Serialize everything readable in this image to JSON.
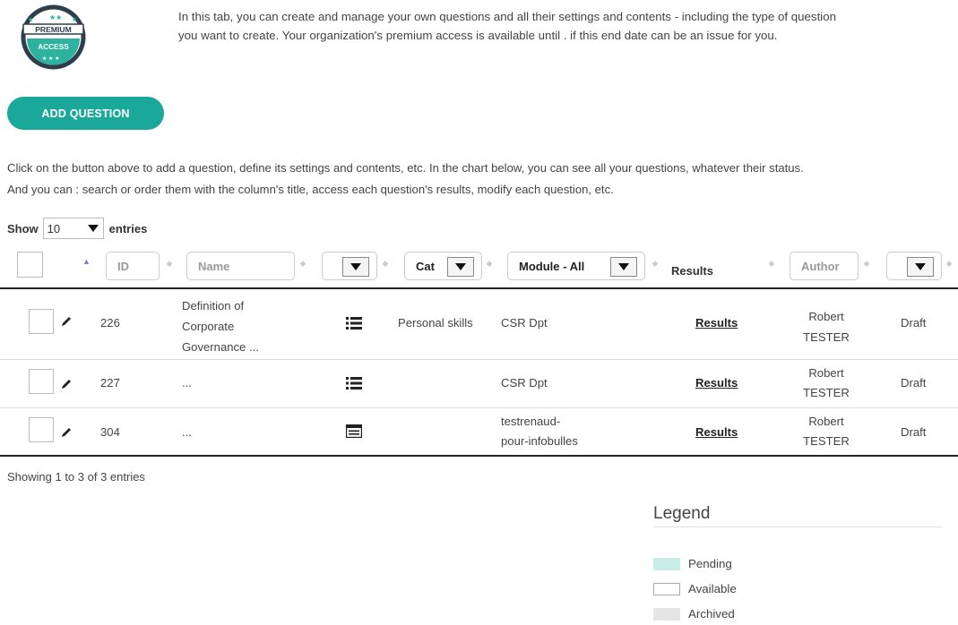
{
  "badge": {
    "top_text": "PREMIUM",
    "bottom_text": "ACCESS"
  },
  "intro": {
    "line1": "In this tab, you can create and manage your own questions and all their settings and contents - including the type of question",
    "line2": "you want to create. Your organization's premium access is available until . if this end date can be an issue for you."
  },
  "add_button": "ADD QUESTION",
  "description": {
    "line1": "Click on the button above to add a question, define its settings and contents, etc. In the chart below, you can see all your questions, whatever their status.",
    "line2": "And you can : search or order them with the column's title, access each question's results, modify each question, etc."
  },
  "show_entries": {
    "show": "Show",
    "value": "10",
    "entries": "entries"
  },
  "filters": {
    "id_placeholder": "ID",
    "name_placeholder": "Name",
    "type_value": "",
    "category_value": "Cat",
    "module_value": "Module - All",
    "results_header": "Results",
    "author_placeholder": "Author",
    "status_value": ""
  },
  "rows": [
    {
      "id": "226",
      "name_l1": "Definition of",
      "name_l2": "Corporate",
      "name_l3": "Governance ...",
      "type_icon": "list-icon",
      "category": "Personal skills",
      "module_l1": "CSR Dpt",
      "module_l2": "",
      "results": "Results",
      "author_l1": "Robert",
      "author_l2": "TESTER",
      "status": "Draft"
    },
    {
      "id": "227",
      "name_l1": "...",
      "name_l2": "",
      "name_l3": "",
      "type_icon": "list-icon",
      "category": "",
      "module_l1": "CSR Dpt",
      "module_l2": "",
      "results": "Results",
      "author_l1": "Robert",
      "author_l2": "TESTER",
      "status": "Draft"
    },
    {
      "id": "304",
      "name_l1": "...",
      "name_l2": "",
      "name_l3": "",
      "type_icon": "form-icon",
      "category": "",
      "module_l1": "testrenaud-",
      "module_l2": "pour-infobulles",
      "results": "Results",
      "author_l1": "Robert",
      "author_l2": "TESTER",
      "status": "Draft"
    }
  ],
  "footer": {
    "showing": "Showing 1 to 3 of 3 entries"
  },
  "legend": {
    "title": "Legend",
    "items": [
      {
        "label": "Pending",
        "color": "#c8ece8"
      },
      {
        "label": "Available",
        "color": "#ffffff"
      },
      {
        "label": "Archived",
        "color": "#e5e5e5"
      }
    ]
  },
  "colors": {
    "accent": "#1aa89a",
    "badge_bg": "#2b3a4a"
  }
}
